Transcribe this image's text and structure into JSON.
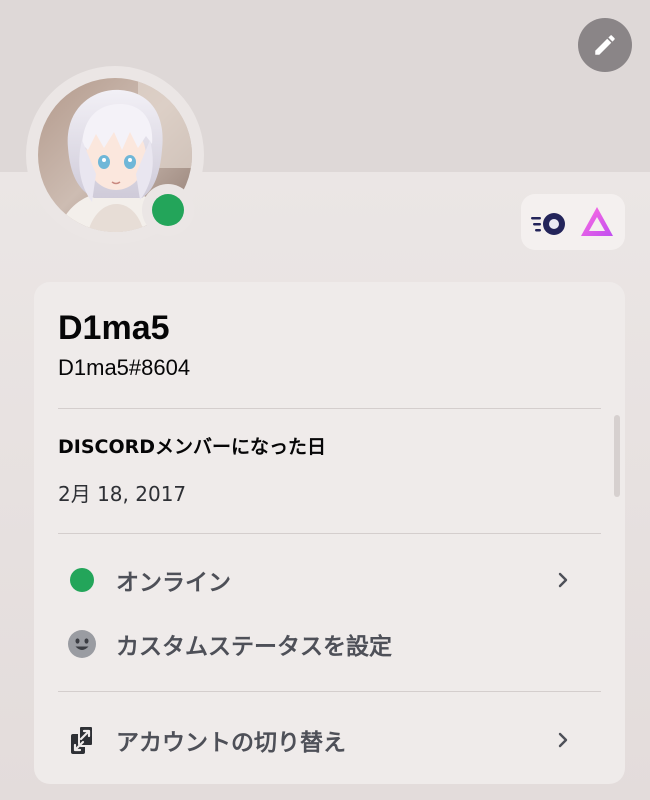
{
  "profile": {
    "display_name": "D1ma5",
    "tag": "D1ma5#8604"
  },
  "member_since": {
    "title": "DISCORDメンバーになった日",
    "date": "2月 18, 2017"
  },
  "menu": {
    "status_label": "オンライン",
    "custom_status_label": "カスタムステータスを設定",
    "switch_account_label": "アカウントの切り替え"
  },
  "badges": [
    "hypesquad-icon",
    "nitro-triangle-icon"
  ],
  "colors": {
    "online": "#23a55a",
    "text_primary": "#060607",
    "text_muted": "#4e5058",
    "card_bg": "#efebea",
    "banner_bg": "#ded8d7"
  }
}
